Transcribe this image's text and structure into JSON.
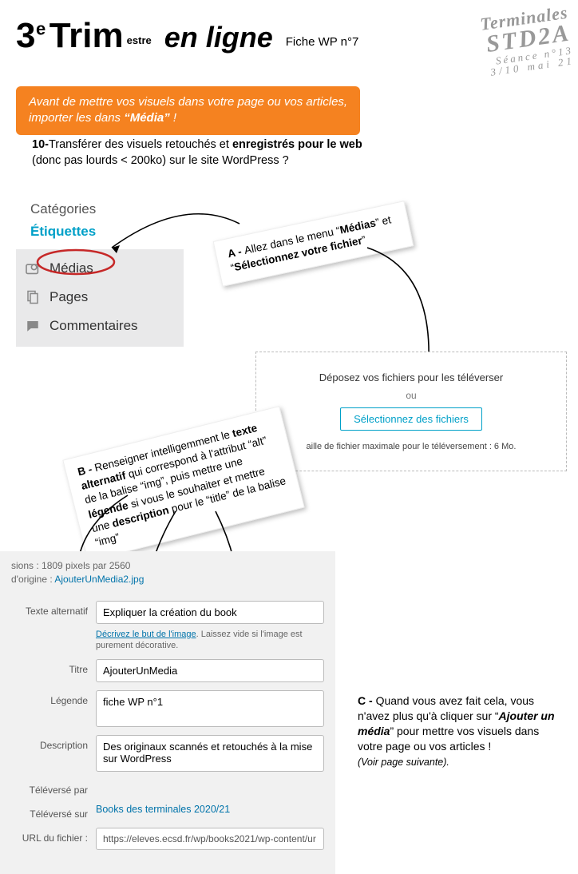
{
  "header": {
    "t3e": "3",
    "te": "e",
    "trim": " Trim",
    "estre": "estre",
    "enligne": "en ligne",
    "fiche": "Fiche WP n°7"
  },
  "stamp": {
    "l1": "Terminales",
    "l2": "STD2A",
    "l3": "Séance n°13",
    "l4": "3/10 mai 21"
  },
  "banner": {
    "line1": "Avant de mettre vos visuels dans votre page ou vos articles,",
    "line2a": "importer les dans ",
    "line2q": "“Média”",
    "line2b": "  !"
  },
  "q10": {
    "num": "10-",
    "a": "Transférer des visuels retouchés et ",
    "b": "enregistrés pour le web",
    "c": " (donc pas lourds < 200ko) sur le site WordPress  ?"
  },
  "sidebar": {
    "cat": "Catégories",
    "etq": "Étiquettes",
    "medias": "Médias",
    "pages": "Pages",
    "comm": "Commentaires"
  },
  "stepA": {
    "lead": "A - ",
    "t1": "Allez dans le menu “",
    "b1": "Médias",
    "t2": "” et “",
    "b2": "Sélectionnez votre fichier",
    "t3": "”"
  },
  "upload": {
    "drop": "Déposez vos fichiers pour les téléverser",
    "or": "ou",
    "btn": "Sélectionnez des fichiers",
    "cap": "aille de fichier maximale pour le téléversement : 6 Mo."
  },
  "stepB": {
    "lead": "B - ",
    "t1": "Renseigner intelligemment le ",
    "b1": "texte alternatif",
    "t2": " qui correspond à l'attribut “alt” de la balise “img”, puis mettre une ",
    "b2": "légende",
    "t3": " si vous le souhaiter et mettre une ",
    "b3": "description",
    "t4": " pour le “title” de la balise “img”"
  },
  "panel": {
    "dims_lbl": "sions :",
    "dims": "1809 pixels par 2560",
    "orig_lbl": "d'origine :",
    "orig": "AjouterUnMedia2.jpg",
    "alt_lbl": "Texte alternatif",
    "alt_val": "Expliquer la création du book",
    "help_link": "Décrivez le but de l'image",
    "help_rest": ". Laissez vide si l'image est purement décorative.",
    "title_lbl": "Titre",
    "title_val": "AjouterUnMedia",
    "leg_lbl": "Légende",
    "leg_val": "fiche WP n°1",
    "desc_lbl": "Description",
    "desc_val": "Des originaux scannés et retouchés à la mise sur WordPress",
    "up_by_lbl": "Téléversé par",
    "up_on_lbl": "Téléversé sur",
    "up_on_val": "Books des terminales 2020/21",
    "url_lbl": "URL du fichier :",
    "url_val": "https://eleves.ecsd.fr/wp/books2021/wp-content/ur"
  },
  "stepC": {
    "lead": "C - ",
    "t1": "Quand vous avez fait cela, vous n'avez plus qu'à  cliquer sur “",
    "b1": "Ajouter un média",
    "t2": "” pour mettre vos visuels dans votre page ou vos articles !",
    "note": "(Voir page suivante)."
  }
}
